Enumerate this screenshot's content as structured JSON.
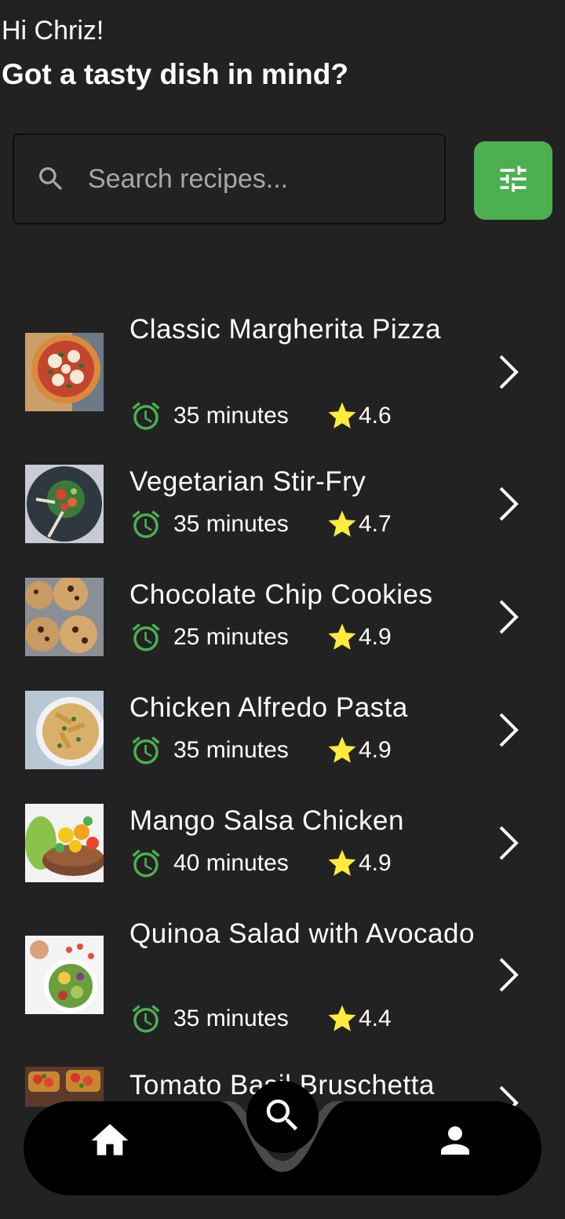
{
  "header": {
    "greeting": "Hi Chriz!",
    "headline": "Got a tasty dish in mind?"
  },
  "search": {
    "placeholder": "Search recipes...",
    "value": "",
    "icon": "search-icon"
  },
  "filter": {
    "icon": "tune-icon",
    "color": "#4caf50"
  },
  "recipes": [
    {
      "title": "Classic Margherita Pizza",
      "time": "35 minutes",
      "rating": "4.6",
      "thumb": "pizza"
    },
    {
      "title": "Vegetarian Stir-Fry",
      "time": "35 minutes",
      "rating": "4.7",
      "thumb": "stirfry"
    },
    {
      "title": "Chocolate Chip Cookies",
      "time": "25 minutes",
      "rating": "4.9",
      "thumb": "cookies"
    },
    {
      "title": "Chicken Alfredo Pasta",
      "time": "35 minutes",
      "rating": "4.9",
      "thumb": "pasta"
    },
    {
      "title": "Mango Salsa Chicken",
      "time": "40 minutes",
      "rating": "4.9",
      "thumb": "mango"
    },
    {
      "title": "Quinoa Salad with Avocado",
      "time": "35 minutes",
      "rating": "4.4",
      "thumb": "quinoa"
    },
    {
      "title": "Tomato Basil Bruschetta",
      "time": "",
      "rating": "",
      "thumb": "bruschetta"
    }
  ],
  "colors": {
    "background": "#222223",
    "accent": "#4caf50",
    "clock": "#4caf50",
    "star": "#ffeb3b",
    "nav_bar": "#000000"
  },
  "bottom_nav": {
    "items": [
      {
        "icon": "home-icon"
      },
      {
        "icon": "search-icon"
      },
      {
        "icon": "person-icon"
      }
    ]
  }
}
